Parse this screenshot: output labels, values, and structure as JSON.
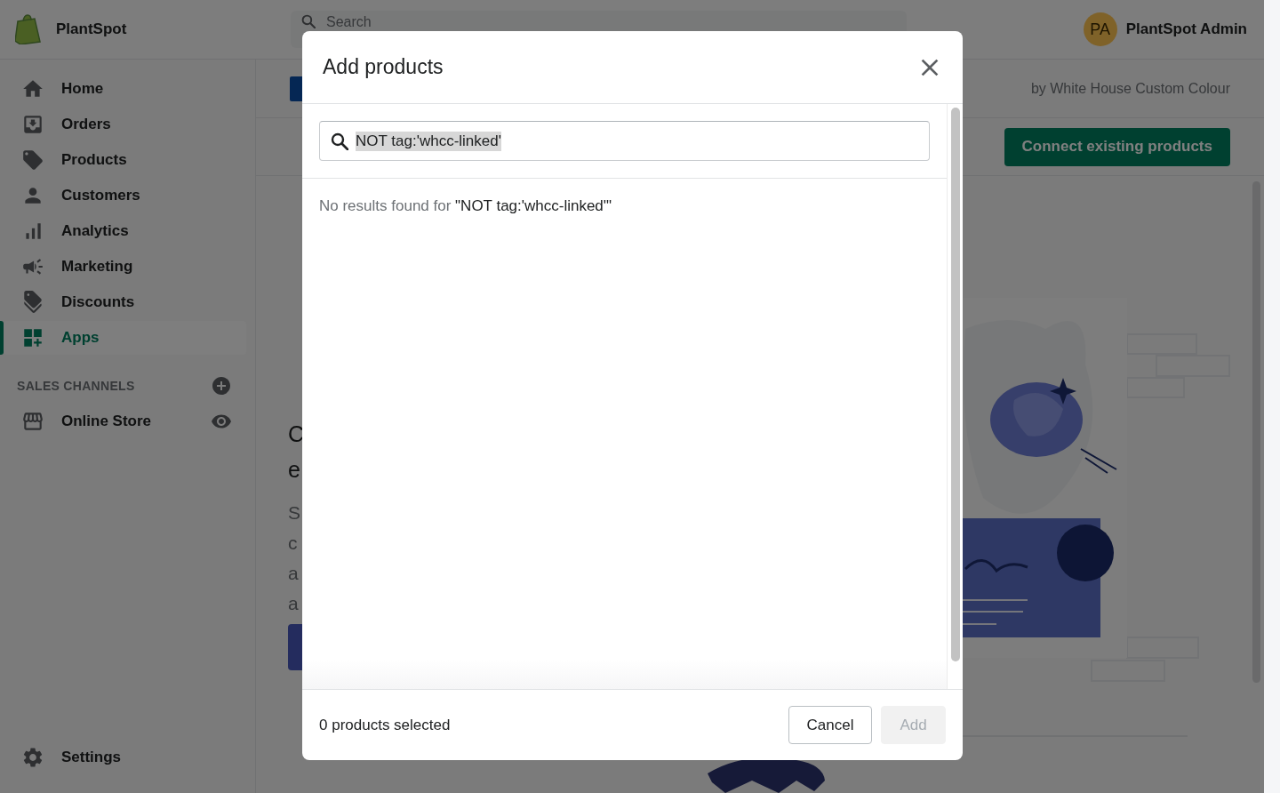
{
  "topbar": {
    "store_name": "PlantSpot",
    "search": {
      "placeholder": "Search"
    },
    "account": {
      "initials": "PA",
      "name": "PlantSpot Admin"
    }
  },
  "sidebar": {
    "items": [
      {
        "label": "Home",
        "selected": false
      },
      {
        "label": "Orders",
        "selected": false
      },
      {
        "label": "Products",
        "selected": false
      },
      {
        "label": "Customers",
        "selected": false
      },
      {
        "label": "Analytics",
        "selected": false
      },
      {
        "label": "Marketing",
        "selected": false
      },
      {
        "label": "Discounts",
        "selected": false
      },
      {
        "label": "Apps",
        "selected": true
      }
    ],
    "sales_channels": {
      "heading": "SALES CHANNELS",
      "items": [
        {
          "label": "Online Store"
        }
      ]
    },
    "settings": {
      "label": "Settings"
    }
  },
  "app_header": {
    "developer": "by White House Custom Colour",
    "primary_action": "Connect existing products"
  },
  "page_fragments": {
    "heading_lines": [
      "C",
      "e"
    ],
    "body_lines": [
      "S",
      "c",
      "a",
      "a"
    ]
  },
  "modal": {
    "title": "Add products",
    "search": {
      "value": "NOT tag:'whcc-linked'",
      "text_selected": true
    },
    "empty_message": {
      "prefix": "No results found for ",
      "query": "\"NOT tag:'whcc-linked'\""
    },
    "selection_count": "0 products selected",
    "buttons": [
      {
        "label": "Cancel",
        "kind": "secondary",
        "disabled": false
      },
      {
        "label": "Add",
        "kind": "primary",
        "disabled": true
      }
    ]
  }
}
